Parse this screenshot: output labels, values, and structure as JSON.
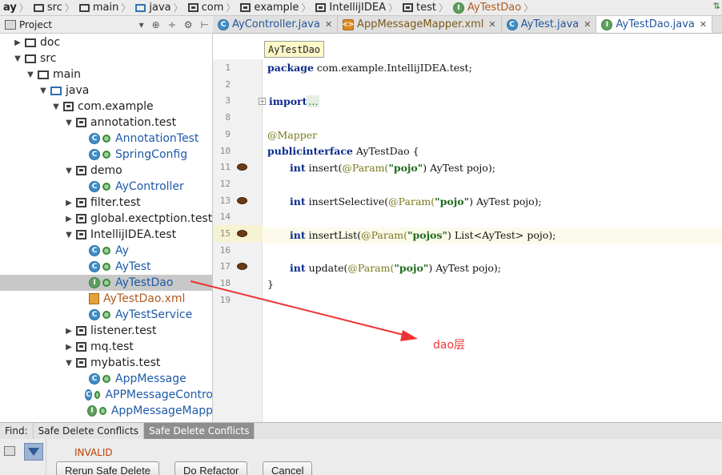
{
  "breadcrumb": [
    "ay",
    "src",
    "main",
    "java",
    "com",
    "example",
    "IntellijIDEA",
    "test",
    "AyTestDao"
  ],
  "project_panel": {
    "title": "Project",
    "dropdown_icon": "chevron-down-icon",
    "tools": [
      "crosshair-icon",
      "collapse-icon",
      "gear-icon",
      "hide-icon"
    ]
  },
  "tabs": [
    {
      "label": "AyController.java",
      "icon": "class",
      "active": false
    },
    {
      "label": "AppMessageMapper.xml",
      "icon": "xml",
      "active": false
    },
    {
      "label": "AyTest.java",
      "icon": "class",
      "active": false
    },
    {
      "label": "AyTestDao.java",
      "icon": "interface",
      "active": true
    }
  ],
  "tree": [
    {
      "label": "doc",
      "kind": "folder",
      "depth": 0,
      "arrow": "right"
    },
    {
      "label": "src",
      "kind": "folder",
      "depth": 0,
      "arrow": "down"
    },
    {
      "label": "main",
      "kind": "folder",
      "depth": 1,
      "arrow": "down"
    },
    {
      "label": "java",
      "kind": "folder-blue",
      "depth": 2,
      "arrow": "down"
    },
    {
      "label": "com.example",
      "kind": "package",
      "depth": 3,
      "arrow": "down"
    },
    {
      "label": "annotation.test",
      "kind": "package",
      "depth": 4,
      "arrow": "down"
    },
    {
      "label": "AnnotationTest",
      "kind": "class",
      "depth": 5,
      "arrow": ""
    },
    {
      "label": "SpringConfig",
      "kind": "class",
      "depth": 5,
      "arrow": ""
    },
    {
      "label": "demo",
      "kind": "package",
      "depth": 4,
      "arrow": "down"
    },
    {
      "label": "AyController",
      "kind": "class",
      "depth": 5,
      "arrow": ""
    },
    {
      "label": "filter.test",
      "kind": "package",
      "depth": 4,
      "arrow": "right"
    },
    {
      "label": "global.exectption.test",
      "kind": "package",
      "depth": 4,
      "arrow": "right"
    },
    {
      "label": "IntellijIDEA.test",
      "kind": "package",
      "depth": 4,
      "arrow": "down"
    },
    {
      "label": "Ay",
      "kind": "class",
      "depth": 5,
      "arrow": ""
    },
    {
      "label": "AyTest",
      "kind": "class",
      "depth": 5,
      "arrow": ""
    },
    {
      "label": "AyTestDao",
      "kind": "interface",
      "depth": 5,
      "arrow": "",
      "selected": true
    },
    {
      "label": "AyTestDao.xml",
      "kind": "xml",
      "depth": 5,
      "arrow": ""
    },
    {
      "label": "AyTestService",
      "kind": "class",
      "depth": 5,
      "arrow": ""
    },
    {
      "label": "listener.test",
      "kind": "package",
      "depth": 4,
      "arrow": "right"
    },
    {
      "label": "mq.test",
      "kind": "package",
      "depth": 4,
      "arrow": "right"
    },
    {
      "label": "mybatis.test",
      "kind": "package",
      "depth": 4,
      "arrow": "down"
    },
    {
      "label": "AppMessage",
      "kind": "class",
      "depth": 5,
      "arrow": ""
    },
    {
      "label": "APPMessageContro",
      "kind": "class",
      "depth": 5,
      "arrow": ""
    },
    {
      "label": "AppMessageMapp",
      "kind": "interface",
      "depth": 5,
      "arrow": ""
    }
  ],
  "tooltip": "AyTestDao",
  "gutter": [
    {
      "num": "1"
    },
    {
      "num": "2"
    },
    {
      "num": "3"
    },
    {
      "num": "8"
    },
    {
      "num": "9"
    },
    {
      "num": "10"
    },
    {
      "num": "11",
      "bean": true
    },
    {
      "num": "12"
    },
    {
      "num": "13",
      "bean": true
    },
    {
      "num": "14"
    },
    {
      "num": "15",
      "bean": true,
      "current": true
    },
    {
      "num": "16"
    },
    {
      "num": "17",
      "bean": true
    },
    {
      "num": "18"
    },
    {
      "num": "19"
    }
  ],
  "code": {
    "l1_kw": "package",
    "l1_rest": " com.example.IntellijIDEA.test;",
    "l3_kw": "import",
    "l3_dots": "...",
    "l8": "@Mapper",
    "l9_kw1": "public",
    "l9_kw2": "interface",
    "l9_rest": " AyTestDao {",
    "int_kw": "int",
    "l10_a": " insert(",
    "l10_ann": "@Param(",
    "l10_str": "\"pojo\"",
    "l10_b": ") AyTest pojo);",
    "l12_a": " insertSelective(",
    "l12_ann": "@Param(",
    "l12_str": "\"pojo\"",
    "l12_b": ") AyTest pojo);",
    "l14_a": " insertList(",
    "l14_ann": "@Param(",
    "l14_str": "\"pojos\"",
    "l14_b": ") List<AyTest> pojo);",
    "l16_a": " update(",
    "l16_ann": "@Param(",
    "l16_str": "\"pojo\"",
    "l16_b": ") AyTest pojo);",
    "l17": "}"
  },
  "find": {
    "label": "Find:",
    "tabs": [
      "Safe Delete Conflicts",
      "Safe Delete Conflicts"
    ],
    "status": "INVALID",
    "buttons": [
      "Rerun Safe Delete",
      "Do Refactor",
      "Cancel"
    ]
  },
  "annotation": {
    "text": "dao层",
    "color": "#ee3333"
  }
}
